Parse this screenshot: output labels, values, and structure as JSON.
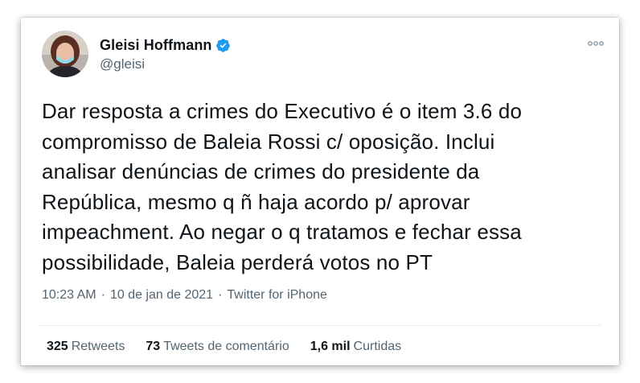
{
  "author": {
    "display_name": "Gleisi Hoffmann",
    "handle": "@gleisi",
    "verified": true,
    "verified_color": "#1d9bf0"
  },
  "tweet": {
    "text": "Dar resposta a crimes do Executivo é o item 3.6 do\ncompromisso de Baleia Rossi c/ oposição. Inclui\nanalisar denúncias de crimes do presidente da\nRepública, mesmo q ñ haja acordo p/ aprovar\nimpeachment. Ao negar o q tratamos e fechar essa\npossibilidade, Baleia perderá votos no PT"
  },
  "meta": {
    "time": "10:23 AM",
    "separator": "·",
    "date": "10 de jan de 2021",
    "source": "Twitter for iPhone"
  },
  "stats": {
    "retweets_count": "325",
    "retweets_label": "Retweets",
    "quote_count": "73",
    "quote_label": "Tweets de comentário",
    "likes_count": "1,6 mil",
    "likes_label": "Curtidas"
  },
  "colors": {
    "text": "#0f1419",
    "secondary": "#536471",
    "divider": "#e6ecf0"
  },
  "icons": {
    "more": "more-dots-icon",
    "verified": "verified-badge-icon"
  }
}
